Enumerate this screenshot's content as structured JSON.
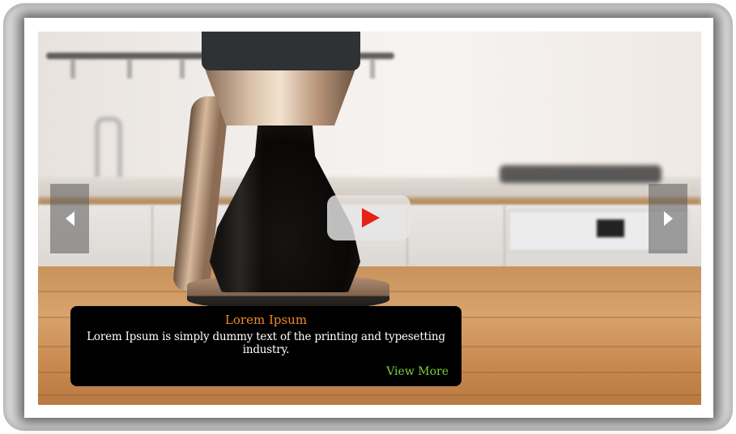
{
  "slider": {
    "video": {
      "play_icon": "play-icon",
      "play_color": "#e62117"
    },
    "nav": {
      "prev_icon": "chevron-left-icon",
      "next_icon": "chevron-right-icon"
    },
    "caption": {
      "title": "Lorem Ipsum",
      "text": "Lorem Ipsum is simply dummy text of the printing and typesetting industry.",
      "link_label": "View More",
      "title_color": "#f08a24",
      "link_color": "#7ad23a"
    }
  }
}
